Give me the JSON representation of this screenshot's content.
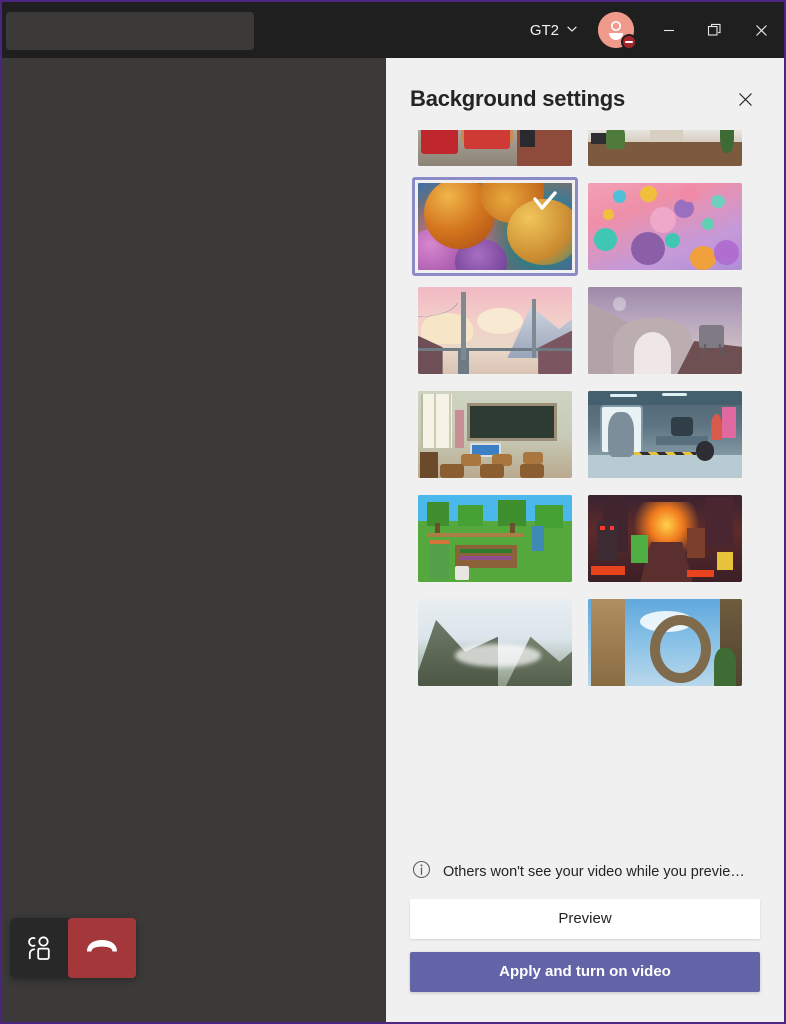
{
  "window": {
    "accent_border": "#4b2580",
    "titlebar_bg": "#201f1f"
  },
  "titlebar": {
    "search_placeholder": "",
    "search_value": "",
    "org_label": "GT2",
    "org_chevron_icon": "chevron-down-icon",
    "avatar_icon": "avatar",
    "avatar_color": "#ef9a8a",
    "presence_status": "Do not disturb",
    "presence_color": "#a4262c",
    "minimize_label": "Minimize",
    "restore_label": "Restore",
    "close_label": "Close"
  },
  "call_controls": {
    "people_label": "Show participants",
    "hangup_label": "Leave",
    "hangup_color": "#a4373a"
  },
  "panel": {
    "title": "Background settings",
    "close_label": "Close",
    "notice": "Others won't see your video while you previe…",
    "notice_icon": "info-icon",
    "preview_label": "Preview",
    "apply_label": "Apply and turn on video",
    "apply_color": "#6264a7",
    "selected_index": 2,
    "backgrounds": [
      {
        "name": "Lounge with red chairs",
        "style": "bg-lounge",
        "selected": false,
        "clipped": "top"
      },
      {
        "name": "Bright office table",
        "style": "bg-office",
        "selected": false,
        "clipped": "top"
      },
      {
        "name": "Abstract balloons",
        "style": "bg-balloons",
        "selected": true,
        "clipped": "none"
      },
      {
        "name": "Colorful spheres",
        "style": "bg-spheres",
        "selected": false,
        "clipped": "none"
      },
      {
        "name": "Suspension bridge",
        "style": "bg-bridge",
        "selected": false,
        "clipped": "none"
      },
      {
        "name": "Lunar arch lander",
        "style": "bg-arch",
        "selected": false,
        "clipped": "none"
      },
      {
        "name": "Classroom",
        "style": "bg-class",
        "selected": false,
        "clipped": "none"
      },
      {
        "name": "Space laboratory",
        "style": "bg-lab",
        "selected": false,
        "clipped": "none"
      },
      {
        "name": "Minecraft village",
        "style": "bg-mcday",
        "selected": false,
        "clipped": "none"
      },
      {
        "name": "Minecraft nether",
        "style": "bg-mcnether",
        "selected": false,
        "clipped": "none"
      },
      {
        "name": "Mountain valley",
        "style": "bg-mtn",
        "selected": false,
        "clipped": "bottom"
      },
      {
        "name": "Ancient stone arch",
        "style": "bg-ruin",
        "selected": false,
        "clipped": "bottom"
      }
    ]
  }
}
